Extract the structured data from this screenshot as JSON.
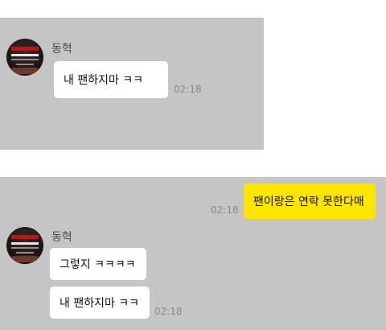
{
  "top": {
    "sender": "동혁",
    "messages": [
      {
        "text": "내 팬하지마 ㅋㅋ",
        "time": "02:18"
      }
    ]
  },
  "bottom": {
    "my_message": {
      "text": "팬이랑은 연락 못한다매",
      "time": "02:18"
    },
    "sender": "동혁",
    "messages": [
      {
        "text": "그렇지 ㅋㅋㅋㅋ"
      },
      {
        "text": "내 팬하지마 ㅋㅋ",
        "time": "02:18"
      }
    ]
  },
  "colors": {
    "panel_bg": "#c5c5c5",
    "bubble_other": "#ffffff",
    "bubble_mine": "#fee500"
  }
}
